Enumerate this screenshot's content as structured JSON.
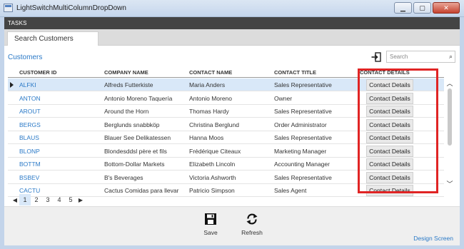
{
  "window": {
    "title": "LightSwitchMultiColumnDropDown",
    "minimize_glyph": "▁",
    "maximize_glyph": "▢",
    "close_glyph": "✕"
  },
  "tasks_label": "TASKS",
  "tab": {
    "label": "Search Customers"
  },
  "section": {
    "title": "Customers"
  },
  "search": {
    "placeholder": "Search",
    "icon": "magnifier-icon"
  },
  "grid": {
    "headers": [
      "CUSTOMER ID",
      "COMPANY NAME",
      "CONTACT NAME",
      "CONTACT TITLE",
      "CONTACT DETAILS"
    ],
    "selected_index": 0,
    "rows": [
      {
        "id": "ALFKI",
        "company": "Alfreds Futterkiste",
        "contact": "Maria Anders",
        "title": "Sales Representative",
        "details": "Contact Details"
      },
      {
        "id": "ANTON",
        "company": "Antonio Moreno Taquería",
        "contact": "Antonio Moreno",
        "title": "Owner",
        "details": "Contact Details"
      },
      {
        "id": "AROUT",
        "company": "Around the Horn",
        "contact": "Thomas Hardy",
        "title": "Sales Representative",
        "details": "Contact Details"
      },
      {
        "id": "BERGS",
        "company": "Berglunds snabbköp",
        "contact": "Christina Berglund",
        "title": "Order Administrator",
        "details": "Contact Details"
      },
      {
        "id": "BLAUS",
        "company": "Blauer See Delikatessen",
        "contact": "Hanna Moos",
        "title": "Sales Representative",
        "details": "Contact Details"
      },
      {
        "id": "BLONP",
        "company": "Blondesddsl père et fils",
        "contact": "Frédérique Citeaux",
        "title": "Marketing Manager",
        "details": "Contact Details"
      },
      {
        "id": "BOTTM",
        "company": "Bottom-Dollar Markets",
        "contact": "Elizabeth Lincoln",
        "title": "Accounting Manager",
        "details": "Contact Details"
      },
      {
        "id": "BSBEV",
        "company": "B's Beverages",
        "contact": "Victoria Ashworth",
        "title": "Sales Representative",
        "details": "Contact Details"
      },
      {
        "id": "CACTU",
        "company": "Cactus Comidas para llevar",
        "contact": "Patricio Simpson",
        "title": "Sales Agent",
        "details": "Contact Details"
      }
    ]
  },
  "pager": {
    "pages": [
      "1",
      "2",
      "3",
      "4",
      "5"
    ],
    "current": "1",
    "prev_glyph": "◀",
    "next_glyph": "▶"
  },
  "commands": {
    "save": "Save",
    "refresh": "Refresh"
  },
  "design_screen": "Design Screen",
  "colors": {
    "accent": "#2a79c7",
    "highlight_box": "#e02424",
    "selected_row": "#d9e8f8"
  }
}
